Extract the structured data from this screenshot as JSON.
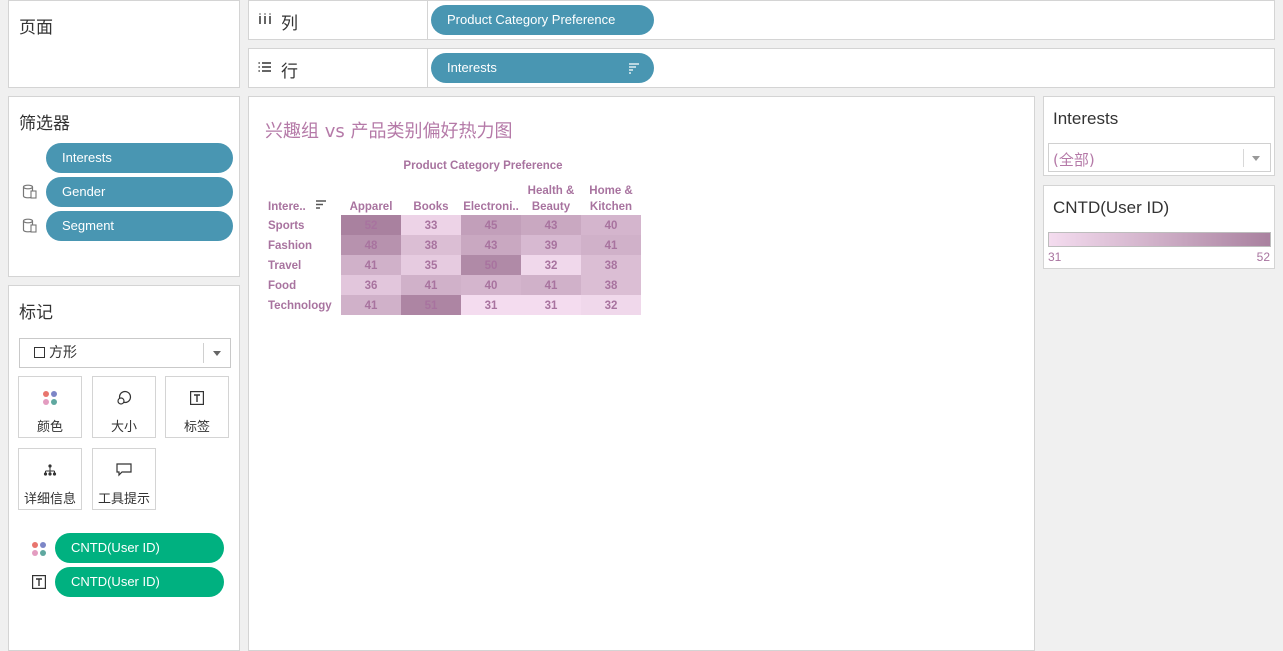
{
  "pages_panel": {
    "title": "页面"
  },
  "filters_panel": {
    "title": "筛选器",
    "pills": [
      "Interests",
      "Gender",
      "Segment"
    ]
  },
  "marks_panel": {
    "title": "标记",
    "mark_type": "方形",
    "buttons": [
      {
        "label": "颜色",
        "icon": "color-icon"
      },
      {
        "label": "大小",
        "icon": "size-icon"
      },
      {
        "label": "标签",
        "icon": "label-icon"
      },
      {
        "label": "详细信息",
        "icon": "detail-icon"
      },
      {
        "label": "工具提示",
        "icon": "tooltip-icon"
      }
    ],
    "fields": [
      {
        "label": "CNTD(User ID)",
        "icon": "color-icon"
      },
      {
        "label": "CNTD(User ID)",
        "icon": "label-icon"
      }
    ]
  },
  "columns_shelf": {
    "label": "列",
    "pill": "Product Category Preference"
  },
  "rows_shelf": {
    "label": "行",
    "pill": "Interests"
  },
  "viz": {
    "title": "兴趣组 vs 产品类别偏好热力图",
    "column_header": "Product Category Preference",
    "row_header": "Intere.."
  },
  "chart_data": {
    "type": "heatmap",
    "title": "兴趣组 vs 产品类别偏好热力图",
    "xlabel": "Product Category Preference",
    "ylabel": "Intere..",
    "columns": [
      "Apparel",
      "Books",
      "Electroni..",
      "Health &\nBeauty",
      "Home &\nKitchen"
    ],
    "rows": [
      "Sports",
      "Fashion",
      "Travel",
      "Food",
      "Technology"
    ],
    "values": [
      [
        52,
        33,
        45,
        43,
        40
      ],
      [
        48,
        38,
        43,
        39,
        41
      ],
      [
        41,
        35,
        50,
        32,
        38
      ],
      [
        36,
        41,
        40,
        41,
        38
      ],
      [
        41,
        51,
        31,
        31,
        32
      ]
    ],
    "color_min": "#f4dcef",
    "color_max": "#a9819f",
    "range": [
      31,
      52
    ]
  },
  "interests_filter": {
    "title": "Interests",
    "value": "(全部)"
  },
  "legend": {
    "title": "CNTD(User ID)",
    "min_label": "31",
    "max_label": "52"
  },
  "colors": {
    "pill_blue": "#4996b2",
    "pill_green": "#00b180",
    "title_pink": "#b57aa8"
  }
}
